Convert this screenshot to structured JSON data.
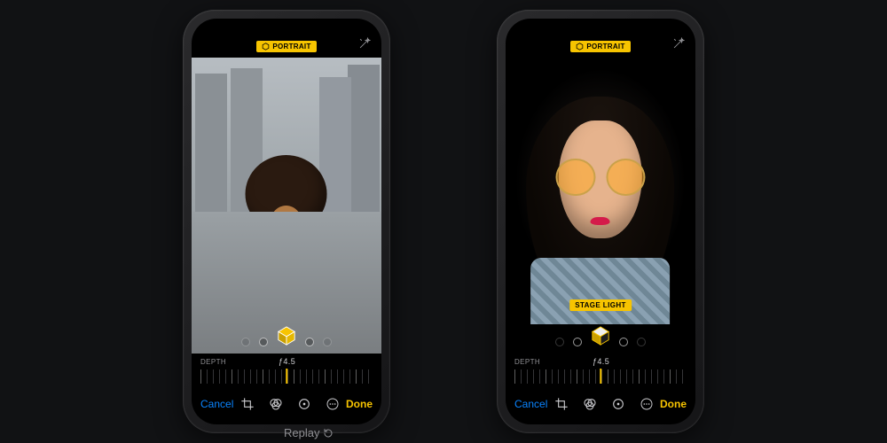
{
  "colors": {
    "accent": "#f7c400",
    "link": "#0a84ff",
    "muted": "#8e8e92"
  },
  "replay_label": "Replay",
  "phones": [
    {
      "id": "left",
      "mode_badge": "PORTRAIT",
      "lighting_label": null,
      "depth": {
        "label": "DEPTH",
        "value_text": "ƒ4.5",
        "value": 4.5,
        "min": 1.4,
        "max": 16
      },
      "toolbar": {
        "cancel": "Cancel",
        "done": "Done",
        "icons": [
          "crop-icon",
          "filters-icon",
          "adjust-icon",
          "more-icon"
        ]
      }
    },
    {
      "id": "right",
      "mode_badge": "PORTRAIT",
      "lighting_label": "STAGE LIGHT",
      "depth": {
        "label": "DEPTH",
        "value_text": "ƒ4.5",
        "value": 4.5,
        "min": 1.4,
        "max": 16
      },
      "toolbar": {
        "cancel": "Cancel",
        "done": "Done",
        "icons": [
          "crop-icon",
          "filters-icon",
          "adjust-icon",
          "more-icon"
        ]
      }
    }
  ]
}
